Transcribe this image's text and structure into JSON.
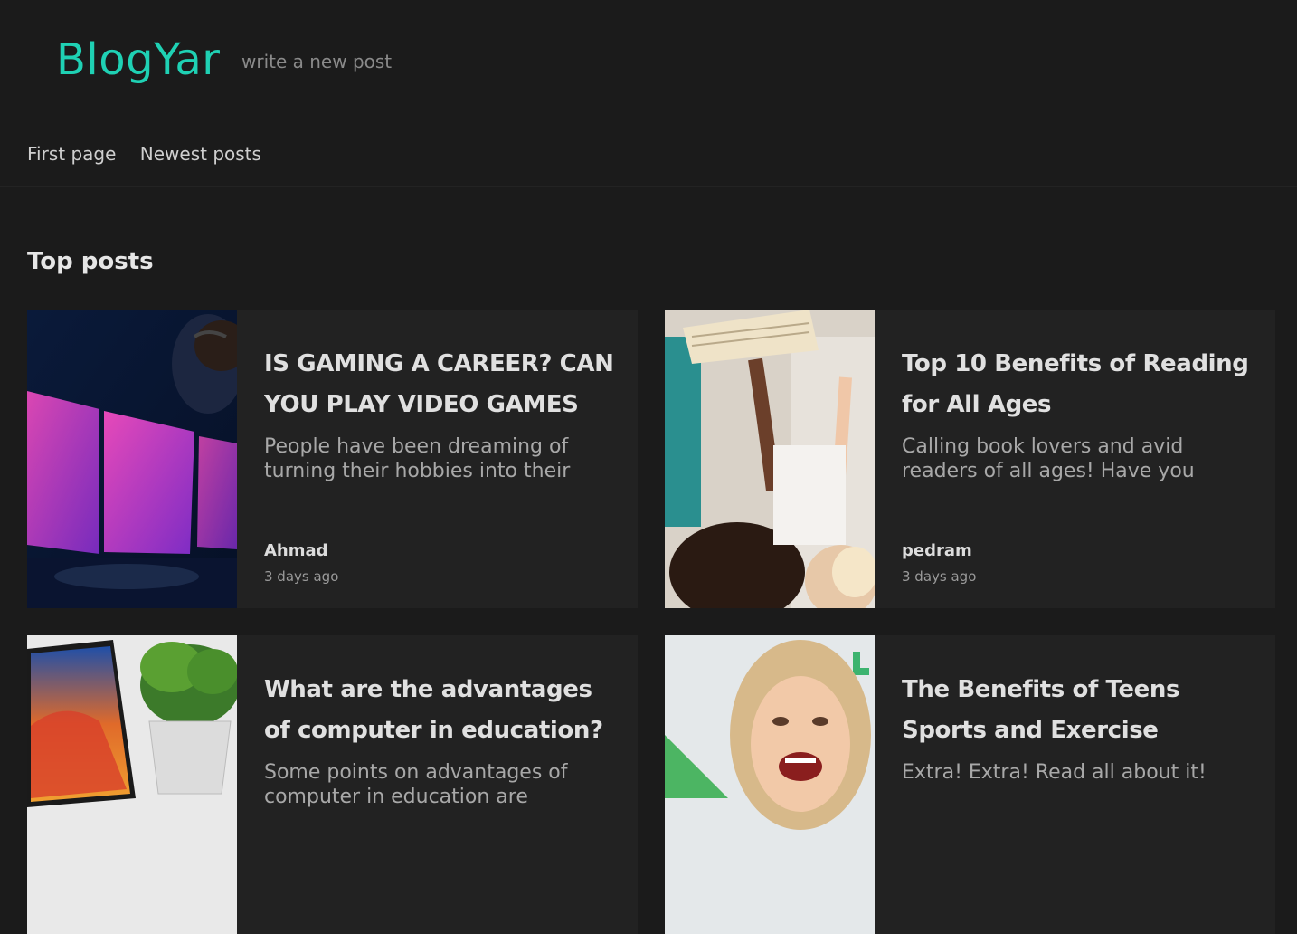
{
  "header": {
    "logo": "BlogYar",
    "write_link": "write a new post",
    "nav": [
      "First page",
      "Newest posts"
    ]
  },
  "section_title": "Top posts",
  "posts": [
    {
      "title": "IS GAMING A CAREER? CAN YOU PLAY VIDEO GAMES AS A...",
      "excerpt": "People have been dreaming of turning their hobbies into their full...",
      "author": "Ahmad",
      "time": "3 days ago"
    },
    {
      "title": "Top 10 Benefits of Reading for All Ages",
      "excerpt": "Calling book lovers and avid readers of all ages! Have you ever...",
      "author": "pedram",
      "time": "3 days ago"
    },
    {
      "title": "What are the advantages of computer in education?",
      "excerpt": "Some points on advantages of computer in education are",
      "author": "",
      "time": ""
    },
    {
      "title": "The Benefits of Teens Sports and Exercise",
      "excerpt": "Extra! Extra! Read all about it!",
      "author": "",
      "time": ""
    }
  ],
  "colors": {
    "accent": "#1fd1b4",
    "background": "#1b1b1b",
    "card": "#222222"
  }
}
